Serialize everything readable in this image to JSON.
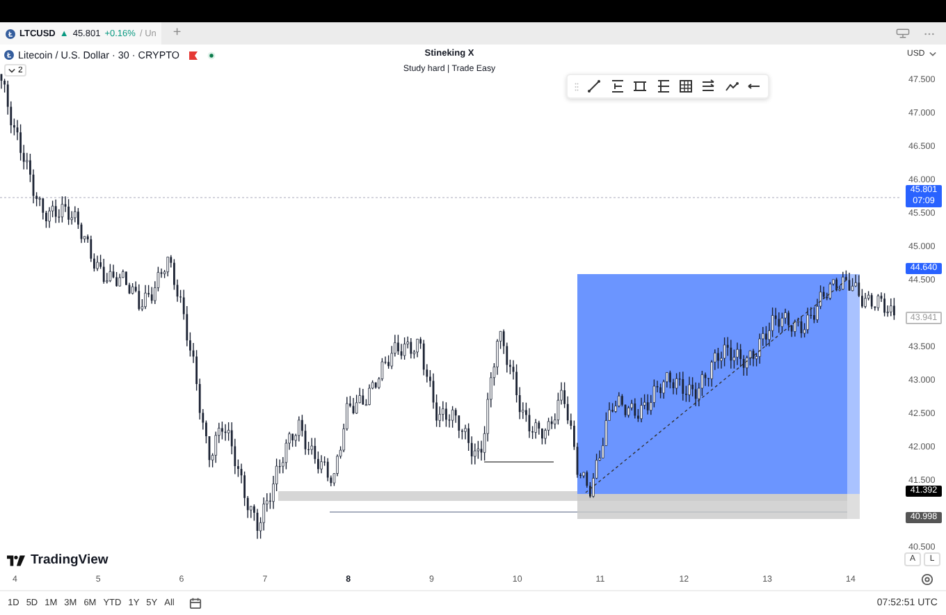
{
  "tab": {
    "symbol": "LTCUSD",
    "direction": "▲",
    "price": "45.801",
    "change": "+0.16%",
    "suffix": "/ Un",
    "add": "+"
  },
  "legend": {
    "title": "Litecoin / U.S. Dollar · 30 · CRYPTO",
    "collapsed_count": "2"
  },
  "header": {
    "title": "Stineking X",
    "subtitle": "Study hard | Trade Easy"
  },
  "currency": "USD",
  "price_axis": [
    "47.500",
    "47.000",
    "46.500",
    "46.000",
    "45.500",
    "45.000",
    "44.500",
    "43.500",
    "43.000",
    "42.500",
    "42.000",
    "41.500",
    "40.500"
  ],
  "price_tags": [
    {
      "kind": "last",
      "label": "45.801",
      "sub": "07:09"
    },
    {
      "kind": "target",
      "label": "44.640"
    },
    {
      "kind": "current",
      "label": "43.941"
    },
    {
      "kind": "entry",
      "label": "41.392"
    },
    {
      "kind": "stop",
      "label": "40.998"
    }
  ],
  "scale_buttons": [
    "A",
    "L"
  ],
  "time_axis": [
    {
      "label": "4",
      "bold": false
    },
    {
      "label": "5",
      "bold": false
    },
    {
      "label": "6",
      "bold": false
    },
    {
      "label": "7",
      "bold": false
    },
    {
      "label": "8",
      "bold": true
    },
    {
      "label": "9",
      "bold": false
    },
    {
      "label": "10",
      "bold": false
    },
    {
      "label": "11",
      "bold": false
    },
    {
      "label": "12",
      "bold": false
    },
    {
      "label": "13",
      "bold": false
    },
    {
      "label": "14",
      "bold": false
    }
  ],
  "brand": "TradingView",
  "ranges": [
    "1D",
    "5D",
    "1M",
    "3M",
    "6M",
    "YTD",
    "1Y",
    "5Y",
    "All"
  ],
  "clock": "07:52:51 UTC"
}
